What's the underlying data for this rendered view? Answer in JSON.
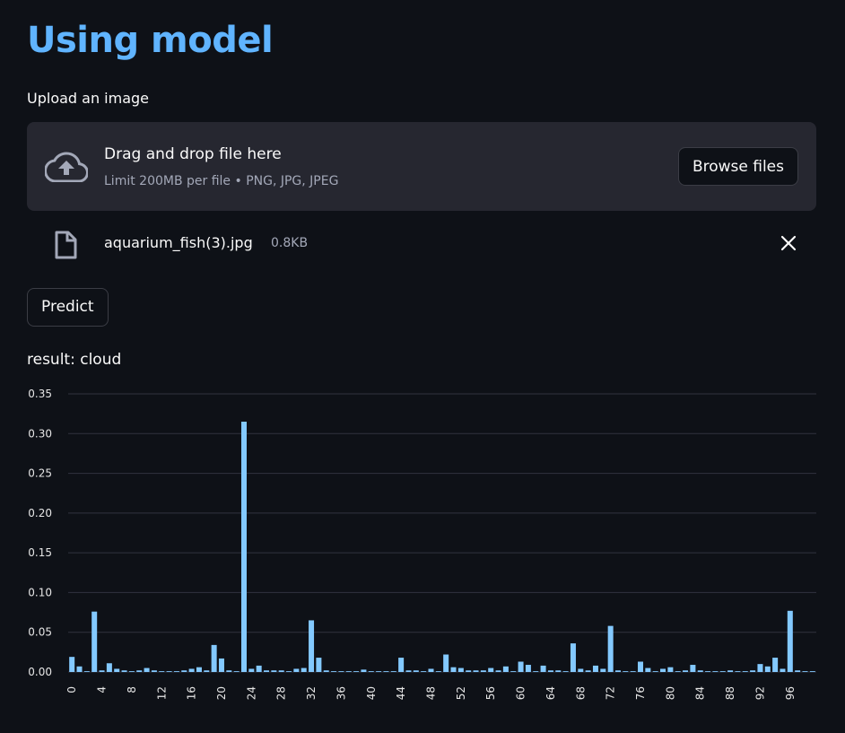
{
  "page": {
    "title": "Using model"
  },
  "uploader": {
    "label": "Upload an image",
    "drop_text": "Drag and drop file here",
    "limit_text": "Limit 200MB per file • PNG, JPG, JPEG",
    "browse_label": "Browse files"
  },
  "file": {
    "name": "aquarium_fish(3).jpg",
    "size": "0.8KB"
  },
  "predict_label": "Predict",
  "result_text": "result: cloud",
  "colors": {
    "accent": "#60b4ff",
    "bar": "#83c9ff",
    "background": "#0e1117",
    "panel": "#262730"
  },
  "chart_data": {
    "type": "bar",
    "title": "",
    "xlabel": "",
    "ylabel": "",
    "ylim": [
      0,
      0.35
    ],
    "yticks": [
      "0.00",
      "0.05",
      "0.10",
      "0.15",
      "0.20",
      "0.25",
      "0.30",
      "0.35"
    ],
    "xticks": [
      "0",
      "4",
      "8",
      "12",
      "16",
      "20",
      "24",
      "28",
      "32",
      "36",
      "40",
      "44",
      "48",
      "52",
      "56",
      "60",
      "64",
      "68",
      "72",
      "76",
      "80",
      "84",
      "88",
      "92",
      "96"
    ],
    "x": [
      0,
      1,
      2,
      3,
      4,
      5,
      6,
      7,
      8,
      9,
      10,
      11,
      12,
      13,
      14,
      15,
      16,
      17,
      18,
      19,
      20,
      21,
      22,
      23,
      24,
      25,
      26,
      27,
      28,
      29,
      30,
      31,
      32,
      33,
      34,
      35,
      36,
      37,
      38,
      39,
      40,
      41,
      42,
      43,
      44,
      45,
      46,
      47,
      48,
      49,
      50,
      51,
      52,
      53,
      54,
      55,
      56,
      57,
      58,
      59,
      60,
      61,
      62,
      63,
      64,
      65,
      66,
      67,
      68,
      69,
      70,
      71,
      72,
      73,
      74,
      75,
      76,
      77,
      78,
      79,
      80,
      81,
      82,
      83,
      84,
      85,
      86,
      87,
      88,
      89,
      90,
      91,
      92,
      93,
      94,
      95,
      96,
      97,
      98,
      99
    ],
    "values": [
      0.019,
      0.007,
      0.001,
      0.076,
      0.002,
      0.011,
      0.004,
      0.002,
      0.001,
      0.002,
      0.005,
      0.002,
      0.001,
      0.001,
      0.001,
      0.002,
      0.004,
      0.006,
      0.002,
      0.034,
      0.017,
      0.002,
      0.001,
      0.315,
      0.004,
      0.008,
      0.002,
      0.002,
      0.002,
      0.001,
      0.004,
      0.005,
      0.065,
      0.018,
      0.002,
      0.001,
      0.001,
      0.001,
      0.001,
      0.003,
      0.001,
      0.001,
      0.001,
      0.001,
      0.018,
      0.002,
      0.002,
      0.001,
      0.004,
      0.001,
      0.022,
      0.006,
      0.005,
      0.002,
      0.002,
      0.002,
      0.005,
      0.002,
      0.007,
      0.001,
      0.013,
      0.009,
      0.001,
      0.008,
      0.002,
      0.002,
      0.001,
      0.036,
      0.004,
      0.002,
      0.008,
      0.004,
      0.058,
      0.002,
      0.001,
      0.001,
      0.013,
      0.005,
      0.001,
      0.004,
      0.006,
      0.001,
      0.002,
      0.009,
      0.002,
      0.001,
      0.001,
      0.001,
      0.002,
      0.001,
      0.001,
      0.002,
      0.01,
      0.007,
      0.018,
      0.004,
      0.077,
      0.002,
      0.001,
      0.001
    ]
  }
}
